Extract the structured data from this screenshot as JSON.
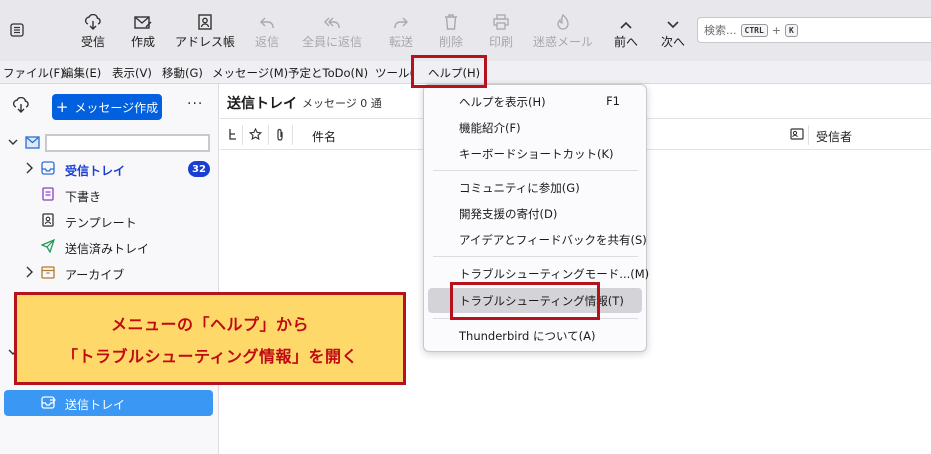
{
  "toolbar": {
    "buttons": [
      {
        "label": "受信",
        "icon": "get-messages-icon"
      },
      {
        "label": "作成",
        "icon": "write-icon"
      },
      {
        "label": "アドレス帳",
        "icon": "address-book-icon"
      },
      {
        "label": "返信",
        "icon": "reply-icon"
      },
      {
        "label": "全員に返信",
        "icon": "reply-all-icon"
      },
      {
        "label": "転送",
        "icon": "forward-icon"
      },
      {
        "label": "削除",
        "icon": "trash-icon"
      },
      {
        "label": "印刷",
        "icon": "print-icon"
      },
      {
        "label": "迷惑メール",
        "icon": "junk-icon"
      },
      {
        "label": "前へ",
        "icon": "chevron-up-icon"
      },
      {
        "label": "次へ",
        "icon": "chevron-down-icon"
      }
    ],
    "search": {
      "placeholder": "検索...",
      "key1": "CTRL",
      "plus": "+",
      "key2": "K"
    }
  },
  "menubar": {
    "items": [
      "ファイル(F)",
      "編集(E)",
      "表示(V)",
      "移動(G)",
      "メッセージ(M)",
      "予定とToDo(N)",
      "ツール(T)",
      "ヘルプ(H)"
    ]
  },
  "folder_pane": {
    "new_message": "メッセージ作成",
    "more": "···",
    "folders": [
      {
        "name": "受信トレイ",
        "badge": "32"
      },
      {
        "name": "下書き"
      },
      {
        "name": "テンプレート"
      },
      {
        "name": "送信済みトレイ"
      },
      {
        "name": "アーカイブ"
      }
    ],
    "selected_folder": "送信トレイ"
  },
  "message_list": {
    "title": "送信トレイ",
    "count": "メッセージ 0 通",
    "columns": {
      "subject": "件名",
      "recipient": "受信者"
    }
  },
  "help_menu": {
    "items": [
      {
        "label": "ヘルプを表示(H)",
        "shortcut": "F1"
      },
      {
        "label": "機能紹介(F)"
      },
      {
        "label": "キーボードショートカット(K)"
      },
      {
        "label": "コミュニティに参加(G)"
      },
      {
        "label": "開発支援の寄付(D)"
      },
      {
        "label": "アイデアとフィードバックを共有(S)"
      },
      {
        "label": "トラブルシューティングモード...(M)"
      },
      {
        "label": "トラブルシューティング情報(T)"
      },
      {
        "label": "Thunderbird について(A)"
      }
    ]
  },
  "annotation": {
    "line1": "メニューの「ヘルプ」から",
    "line2": "「トラブルシューティング情報」を開く"
  },
  "colors": {
    "accent": "#0060df",
    "highlight_red": "#b5121b",
    "callout_bg": "#fed96a",
    "selected_folder": "#3b97f4",
    "badge": "#1a3ed1"
  }
}
